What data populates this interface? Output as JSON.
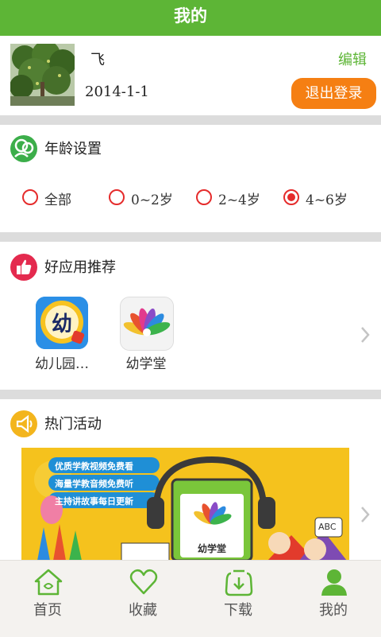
{
  "header": {
    "title": "我的"
  },
  "profile": {
    "name": "飞",
    "date": "2014-1-1",
    "edit_label": "编辑",
    "logout_label": "退出登录"
  },
  "age_section": {
    "title": "年龄设置",
    "options": [
      {
        "label": "全部",
        "selected": false
      },
      {
        "label": "0~2岁",
        "selected": false
      },
      {
        "label": "2~4岁",
        "selected": false
      },
      {
        "label": "4~6岁",
        "selected": true
      }
    ]
  },
  "apps_section": {
    "title": "好应用推荐",
    "apps": [
      {
        "label": "幼儿园…",
        "icon_text": "幼"
      },
      {
        "label": "幼学堂"
      }
    ]
  },
  "activity_section": {
    "title": "热门活动",
    "banner": {
      "lines": [
        "优质学教视频免费看",
        "海量学教音频免费听",
        "主持讲故事每日更新"
      ],
      "brand": "幼学堂",
      "abc": "ABC"
    }
  },
  "tabs": [
    {
      "label": "首页",
      "icon": "home-icon",
      "active": false
    },
    {
      "label": "收藏",
      "icon": "heart-icon",
      "active": false
    },
    {
      "label": "下载",
      "icon": "download-icon",
      "active": false
    },
    {
      "label": "我的",
      "icon": "user-icon",
      "active": true
    }
  ],
  "colors": {
    "brand_green": "#5db536",
    "logout_orange": "#f57f13",
    "radio_red": "#e52b2b",
    "separator": "#dcdcdc"
  }
}
